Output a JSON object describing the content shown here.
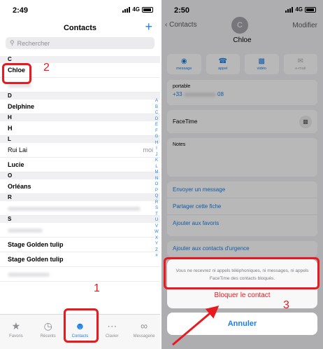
{
  "left": {
    "status": {
      "time": "2:49",
      "network": "4G"
    },
    "nav_title": "Contacts",
    "add_label": "+",
    "search_placeholder": "Rechercher",
    "sections": [
      {
        "letter": "C",
        "rows": [
          "Chloe",
          ""
        ]
      },
      {
        "letter": "D",
        "rows": [
          "Delphine"
        ]
      },
      {
        "letter": "H",
        "rows": [
          "H"
        ]
      },
      {
        "letter": "L",
        "rows": [
          "Rui Lai",
          "Lucie"
        ]
      },
      {
        "letter": "O",
        "rows": [
          "Orléans"
        ]
      },
      {
        "letter": "R",
        "rows": [
          ""
        ]
      },
      {
        "letter": "S",
        "rows": [
          "",
          "Stage Golden tulip",
          "Stage Golden tulip",
          ""
        ]
      }
    ],
    "me_label": "moi",
    "index_letters": "A B C D E F G H I J K L M N O P Q R S T U V W X Y Z #",
    "tabs": [
      "Favoris",
      "Récents",
      "Contacts",
      "Clavier",
      "Messagerie"
    ],
    "annotations": {
      "n1": "1",
      "n2": "2"
    }
  },
  "right": {
    "status": {
      "time": "2:50",
      "network": "4G"
    },
    "back_label": "Contacts",
    "edit_label": "Modifier",
    "avatar_initial": "C",
    "contact_name": "Chloe",
    "actions": [
      "message",
      "appel",
      "vidéo",
      "e-mail"
    ],
    "phone_label": "portable",
    "phone_prefix": "+33",
    "phone_suffix": "08",
    "facetime_label": "FaceTime",
    "notes_label": "Notes",
    "links": [
      "Envoyer un message",
      "Partager cette fiche",
      "Ajouter aux favoris"
    ],
    "emergency_label": "Ajouter aux contacts d'urgence",
    "sheet_message": "Vous ne recevrez ni appels téléphoniques, ni messages, ni appels FaceTime des contacts bloqués.",
    "block_label": "Bloquer le contact",
    "cancel_label": "Annuler",
    "annotation": "3"
  },
  "colors": {
    "accent": "#1a7fe8",
    "annotation": "#e8191f"
  }
}
